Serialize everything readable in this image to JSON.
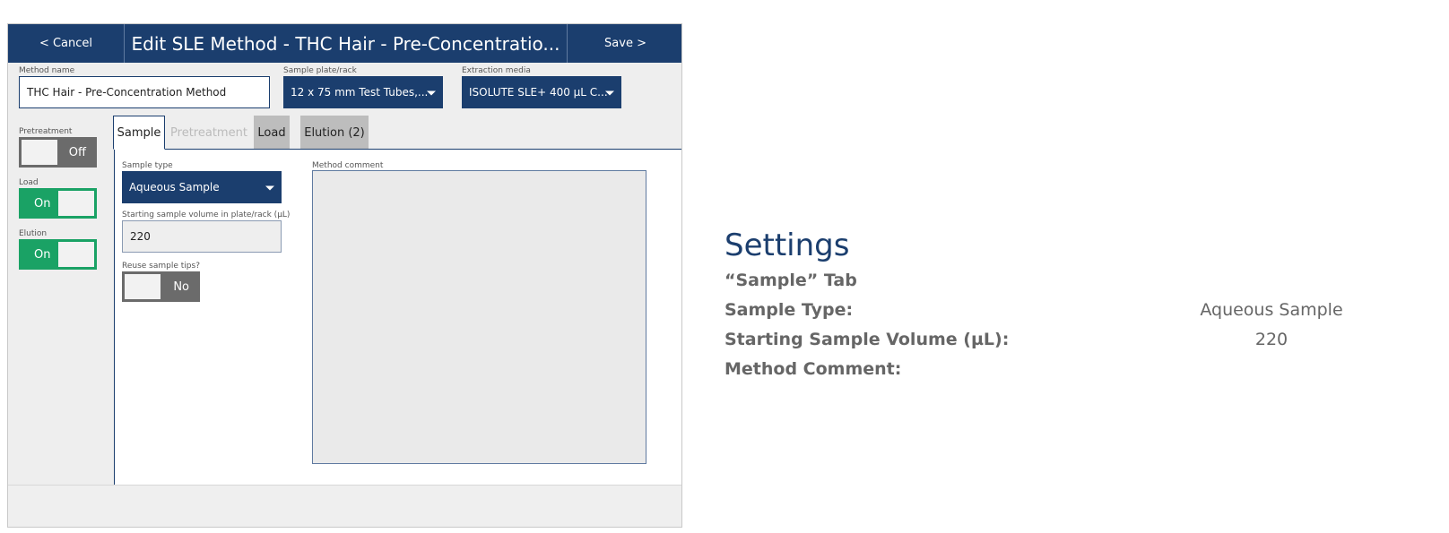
{
  "topbar": {
    "cancel_label": "< Cancel",
    "title": "Edit SLE Method - THC Hair - Pre-Concentratio...",
    "save_label": "Save >"
  },
  "method_name": {
    "label": "Method name",
    "value": "THC Hair - Pre-Concentration Method"
  },
  "sample_plate": {
    "label": "Sample plate/rack",
    "value": "12 x 75 mm Test Tubes,..."
  },
  "extraction_media": {
    "label": "Extraction media",
    "value": "ISOLUTE SLE+ 400 µL C..."
  },
  "toggles": {
    "pretreatment": {
      "label": "Pretreatment",
      "state": "Off"
    },
    "load": {
      "label": "Load",
      "state": "On"
    },
    "elution": {
      "label": "Elution",
      "state": "On"
    }
  },
  "tabs": [
    {
      "label": "Sample",
      "state": "active"
    },
    {
      "label": "Pretreatment",
      "state": "disabled"
    },
    {
      "label": "Load",
      "state": "enabled"
    },
    {
      "label": "Elution (2)",
      "state": "enabled"
    }
  ],
  "sample_tab": {
    "sample_type": {
      "label": "Sample type",
      "value": "Aqueous Sample"
    },
    "starting_volume": {
      "label": "Starting sample volume in plate/rack (µL)",
      "value": "220"
    },
    "reuse_tips": {
      "label": "Reuse sample tips?",
      "state": "No"
    },
    "method_comment": {
      "label": "Method comment",
      "value": ""
    }
  },
  "settings": {
    "title": "Settings",
    "tab_heading": "“Sample” Tab",
    "rows": [
      {
        "label": "Sample Type:",
        "value": "Aqueous Sample"
      },
      {
        "label": "Starting Sample Volume (µL):",
        "value": "220"
      },
      {
        "label": "Method Comment:",
        "value": ""
      }
    ]
  },
  "colors": {
    "navy": "#1b3e6e",
    "toggle_on": "#1aa265",
    "toggle_off": "#6b6b6b"
  }
}
